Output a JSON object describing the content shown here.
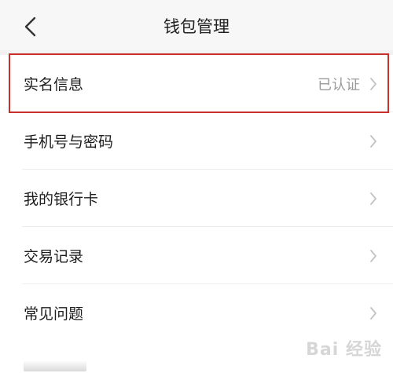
{
  "header": {
    "title": "钱包管理",
    "back_icon": "chevron-left-icon"
  },
  "list": {
    "items": [
      {
        "label": "实名信息",
        "value": "已认证",
        "highlighted": true
      },
      {
        "label": "手机号与密码",
        "value": ""
      },
      {
        "label": "我的银行卡",
        "value": ""
      },
      {
        "label": "交易记录",
        "value": ""
      },
      {
        "label": "常见问题",
        "value": ""
      }
    ]
  },
  "watermark": {
    "text": "Bai 经验"
  },
  "colors": {
    "highlight_border": "#c9302c",
    "value_text": "#9a9a9a",
    "background": "#f2f2f2"
  }
}
